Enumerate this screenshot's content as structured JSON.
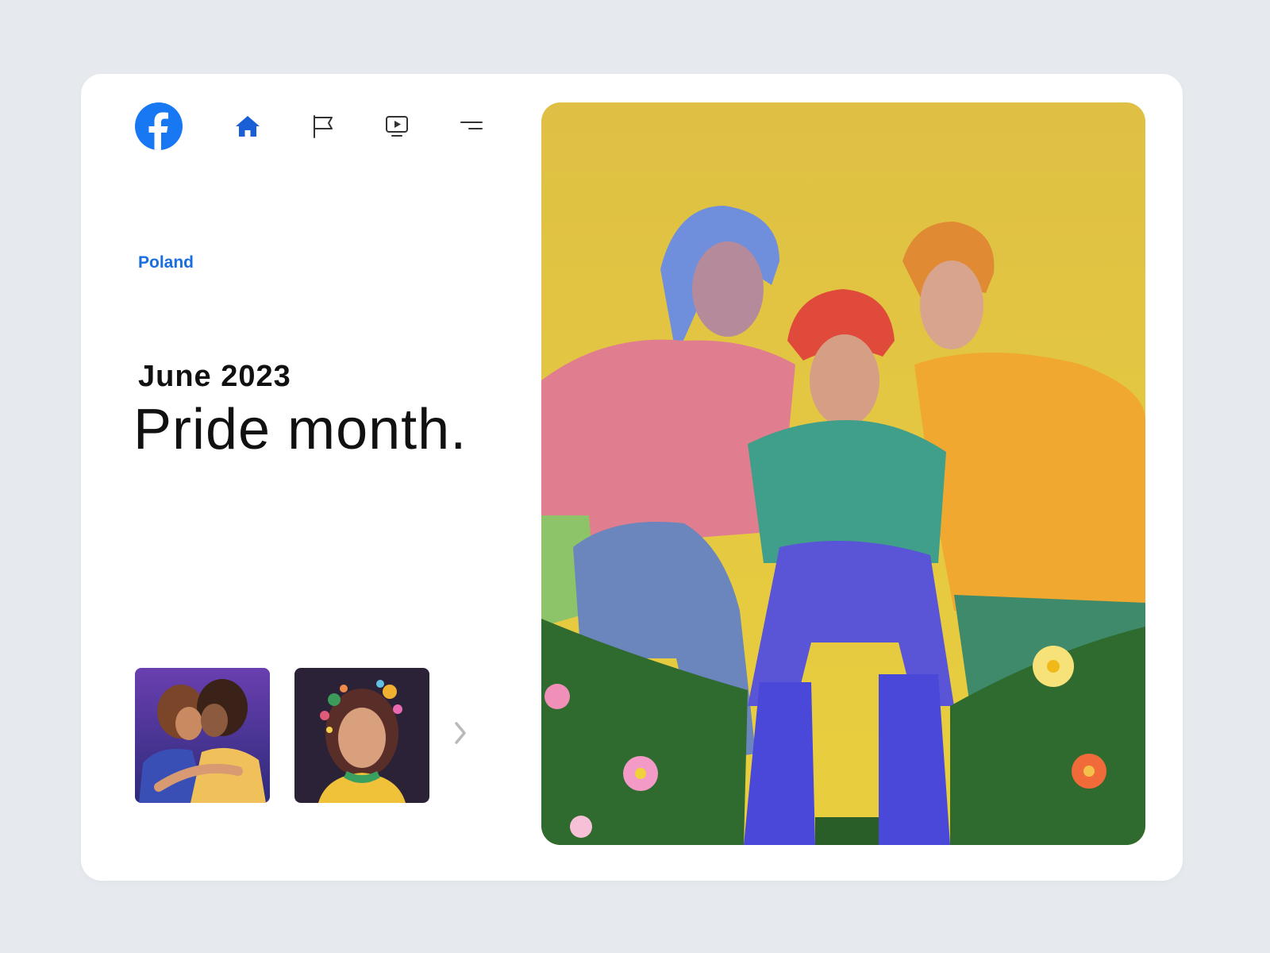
{
  "brand": {
    "icon": "facebook-icon",
    "color": "#1877f2"
  },
  "nav": {
    "items": [
      {
        "icon": "home-icon",
        "active": true,
        "color": "#1a5fd6"
      },
      {
        "icon": "flag-icon",
        "active": false
      },
      {
        "icon": "video-icon",
        "active": false
      },
      {
        "icon": "menu-icon",
        "active": false
      }
    ]
  },
  "hero": {
    "location": "Poland",
    "subtitle": "June 2023",
    "title": "Pride month."
  },
  "gallery": {
    "thumbnails": [
      {
        "description": "two-women-embracing-illustration"
      },
      {
        "description": "girl-with-flowers-illustration"
      }
    ],
    "next_icon": "chevron-right-icon"
  },
  "feature_image": {
    "description": "three-friends-on-grass-illustration",
    "background": "#e3c43f"
  }
}
